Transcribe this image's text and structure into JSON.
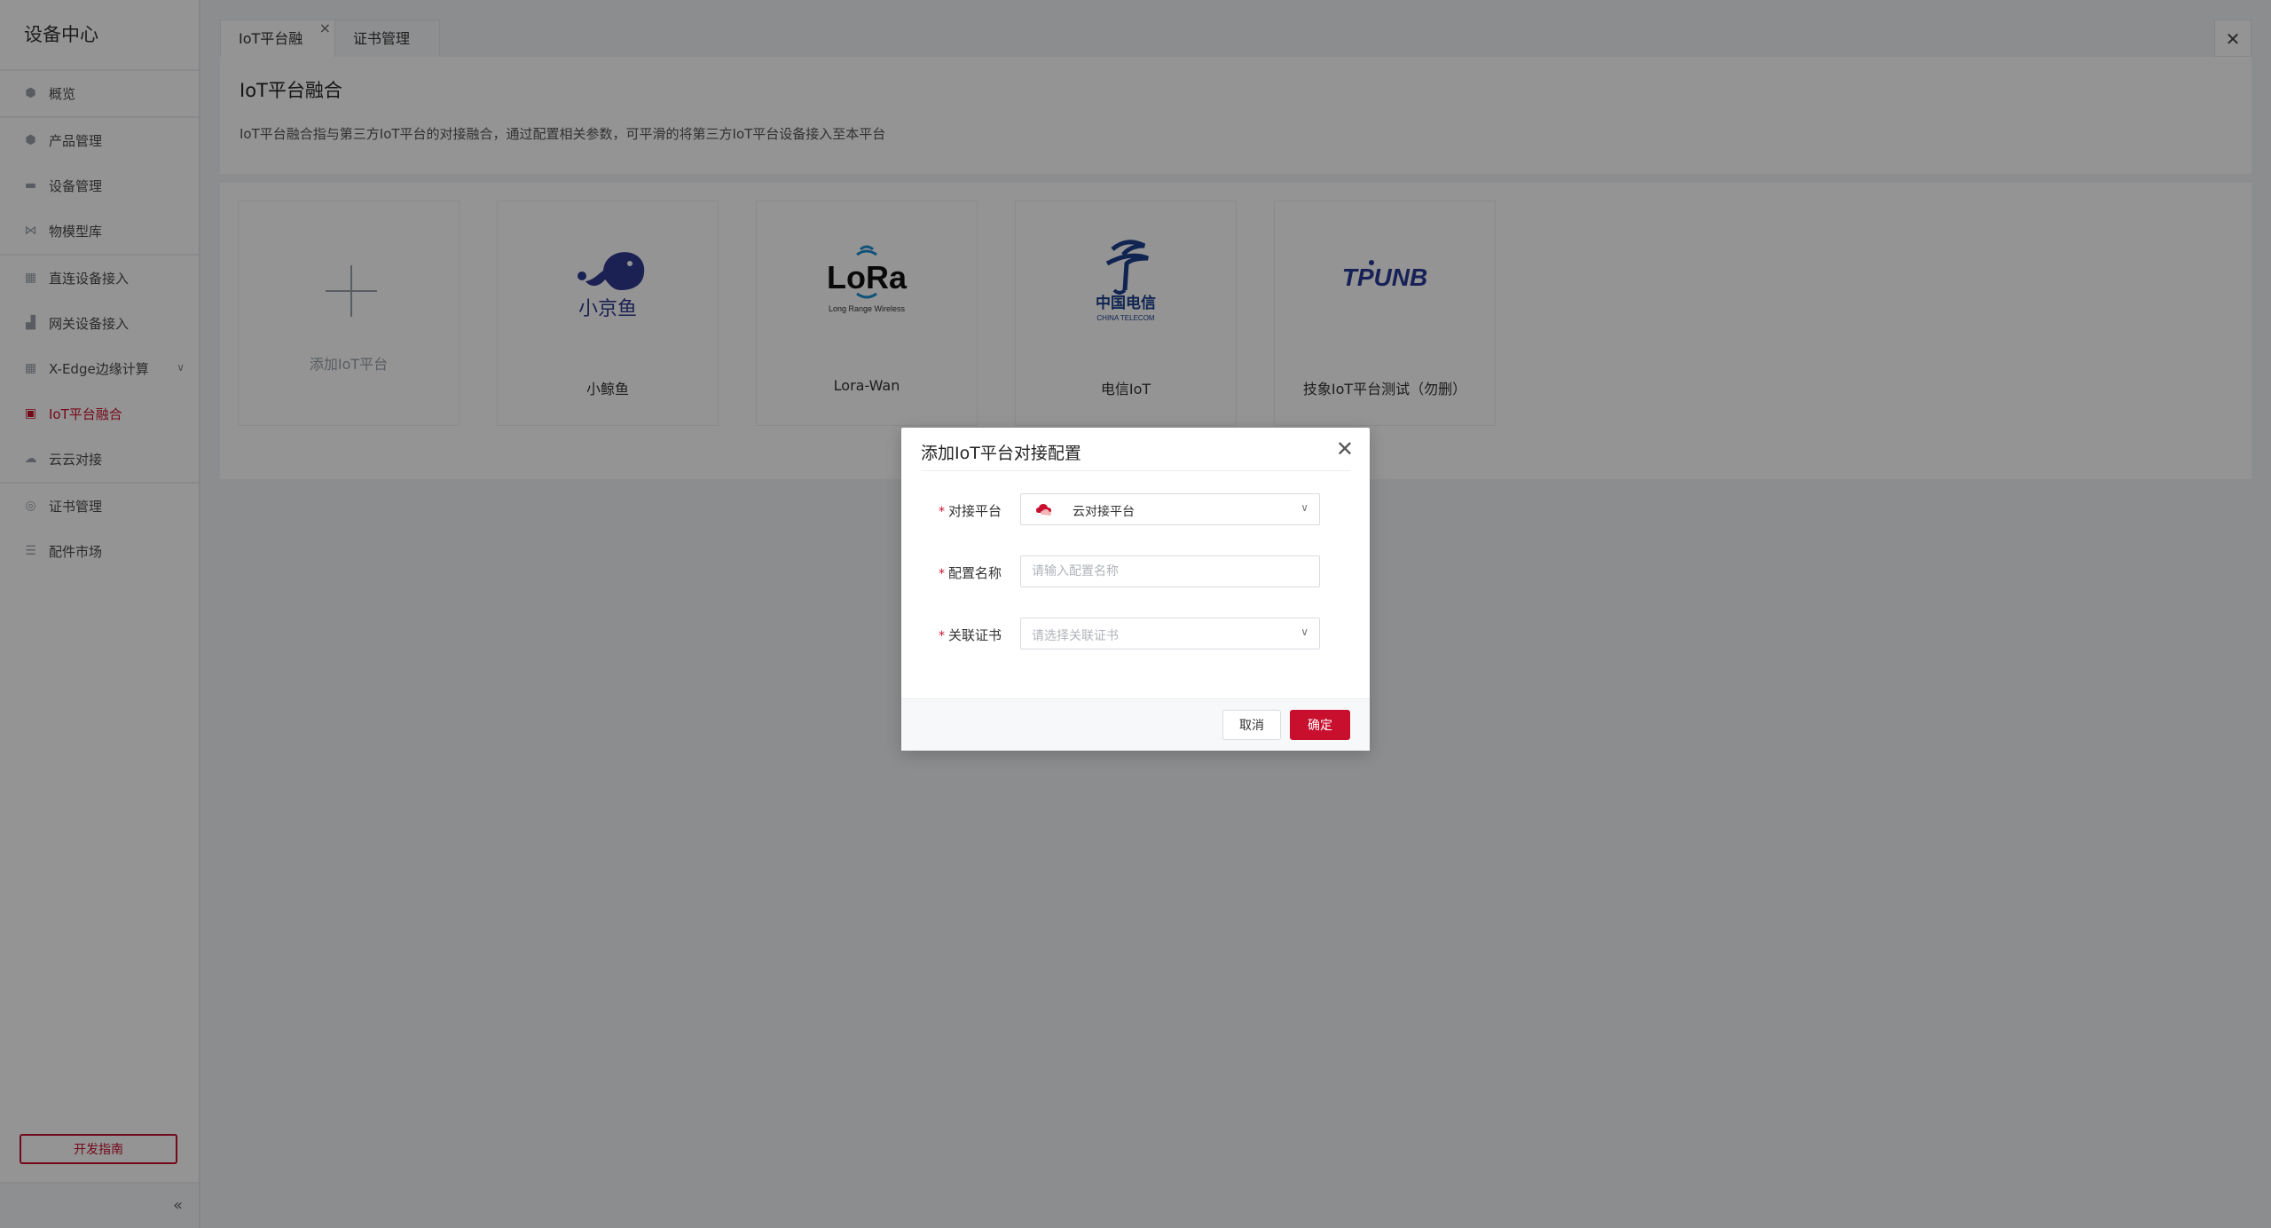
{
  "sidebar": {
    "title": "设备中心",
    "items": [
      {
        "label": "概览",
        "icon": "cube-icon"
      },
      {
        "label": "产品管理",
        "icon": "product-icon"
      },
      {
        "label": "设备管理",
        "icon": "device-icon"
      },
      {
        "label": "物模型库",
        "icon": "model-icon"
      },
      {
        "label": "直连设备接入",
        "icon": "grid-icon"
      },
      {
        "label": "网关设备接入",
        "icon": "gateway-icon"
      },
      {
        "label": "X-Edge边缘计算",
        "icon": "edge-icon"
      },
      {
        "label": "IoT平台融合",
        "icon": "iot-icon"
      },
      {
        "label": "云云对接",
        "icon": "cloud-icon"
      },
      {
        "label": "证书管理",
        "icon": "certificate-icon"
      },
      {
        "label": "配件市场",
        "icon": "market-icon"
      }
    ],
    "dev_guide": "开发指南",
    "collapse": "«"
  },
  "tabs": [
    {
      "label": "IoT平台融合"
    },
    {
      "label": "证书管理"
    }
  ],
  "header": {
    "title": "IoT平台融合",
    "description": "IoT平台融合指与第三方IoT平台的对接融合，通过配置相关参数，可平滑的将第三方IoT平台设备接入至本平台"
  },
  "platforms": {
    "add_label": "添加IoT平台",
    "items": [
      {
        "name": "小鲸鱼",
        "logo_text": "小京鱼"
      },
      {
        "name": "Lora-Wan",
        "logo_text": "LoRa",
        "logo_sub": "Long Range Wireless"
      },
      {
        "name": "电信IoT",
        "logo_text": "中国电信",
        "logo_sub": "CHINA TELECOM"
      },
      {
        "name": "技象IoT平台测试（勿删）",
        "logo_text": "TPUNB"
      }
    ]
  },
  "modal": {
    "title": "添加IoT平台对接配置",
    "fields": {
      "platform": {
        "label": "对接平台",
        "value": "云对接平台"
      },
      "config_name": {
        "label": "配置名称",
        "placeholder": "请输入配置名称"
      },
      "certificate": {
        "label": "关联证书",
        "placeholder": "请选择关联证书"
      }
    },
    "cancel": "取消",
    "confirm": "确定"
  },
  "colors": {
    "accent": "#c8102e",
    "logo_blue": "#2f3a8f",
    "telecom_blue": "#1a3e8c"
  }
}
